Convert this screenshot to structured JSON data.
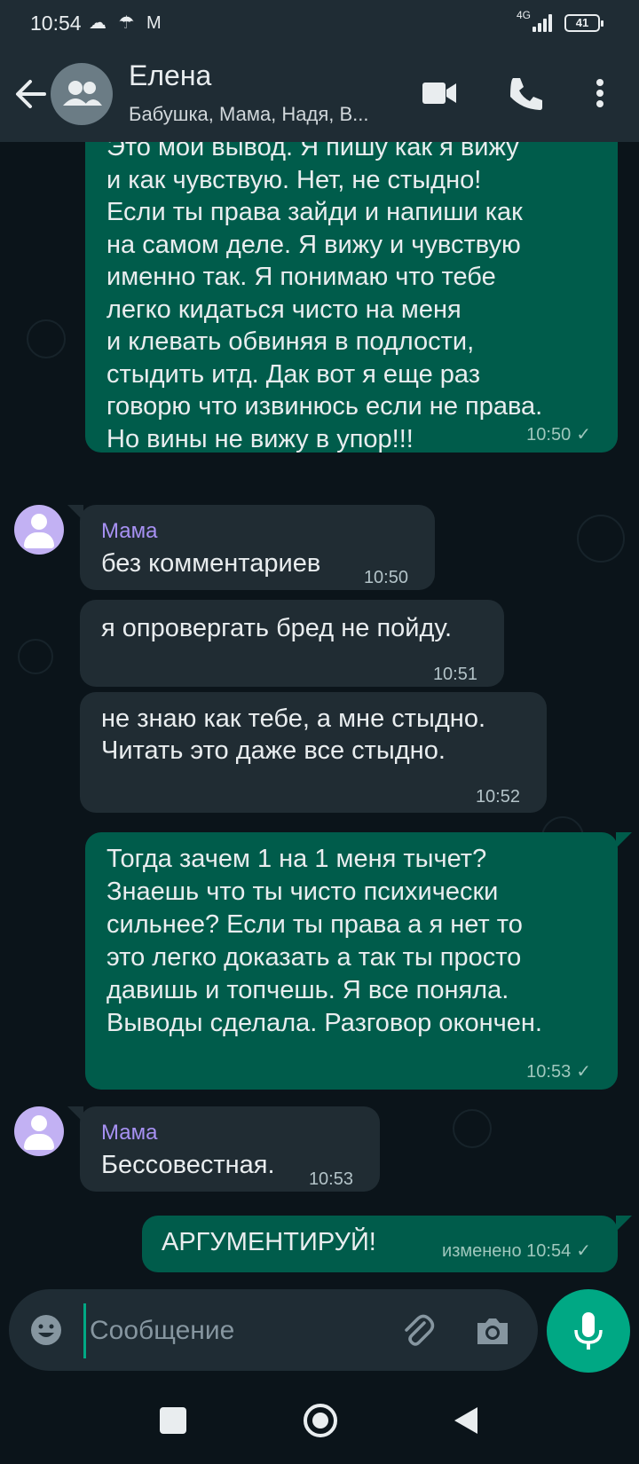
{
  "status_bar": {
    "time": "10:54",
    "icons": "☁ ☂ M",
    "network": "4G",
    "battery": "41"
  },
  "header": {
    "title": "Елена",
    "subtitle": "Бабушка, Мама, Надя, В...",
    "icons": [
      "back-arrow-icon",
      "group-icon",
      "video-call-icon",
      "phone-icon",
      "more-vert-icon"
    ]
  },
  "messages": [
    {
      "dir": "out",
      "text": "Это мой вывод. Я пишу как я вижу\nи как чувствую. Нет, не стыдно!\nЕсли ты права зайди и напиши как\nна самом деле. Я вижу и чувствую\nименно так. Я понимаю что тебе\nлегко кидаться чисто на меня\nи клевать обвиняя в подлости,\nстыдить итд. Дак вот я еще раз\nговорю что извинюсь если не права.\nНо вины не вижу в упор!!!",
      "time": "10:50",
      "status": "✓"
    },
    {
      "dir": "in",
      "sender": "Мама",
      "text": "без комментариев",
      "time": "10:50"
    },
    {
      "dir": "in",
      "text": "я опровергать бред не пойду.",
      "time": "10:51"
    },
    {
      "dir": "in",
      "text": "не знаю как тебе, а мне стыдно.\nЧитать это даже все стыдно.",
      "time": "10:52"
    },
    {
      "dir": "out",
      "text": "Тогда зачем 1 на 1 меня тычет?\nЗнаешь что ты чисто психически\nсильнее? Если ты права а я нет то\nэто легко доказать а так ты просто\nдавишь и топчешь. Я все поняла.\nВыводы сделала. Разговор окончен.",
      "time": "10:53",
      "status": "✓"
    },
    {
      "dir": "in",
      "sender": "Мама",
      "text": "Бессовестная.",
      "time": "10:53"
    },
    {
      "dir": "out",
      "text": "АРГУМЕНТИРУЙ!",
      "edited": "изменено",
      "time": "10:54",
      "status": "✓"
    }
  ],
  "input": {
    "placeholder": "Сообщение",
    "icons": [
      "emoji-icon",
      "attach-icon",
      "camera-icon",
      "mic-icon"
    ]
  },
  "navbar": {
    "icons": [
      "recents-icon",
      "home-icon",
      "back-icon"
    ]
  },
  "colors": {
    "background": "#0b141a",
    "header": "#1f2c34",
    "outgoing_bubble": "#005c4b",
    "incoming_bubble": "#202c33",
    "accent": "#00a884",
    "sender_name": "#a791f3"
  }
}
